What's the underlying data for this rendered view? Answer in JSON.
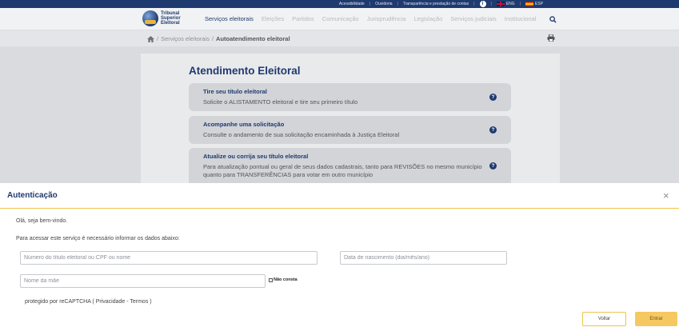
{
  "topbar": {
    "links": [
      "Acessibilidade",
      "Ouvidoria",
      "Transparência e prestação de contas"
    ],
    "languages": [
      "ENG",
      "ESP"
    ]
  },
  "nav": {
    "logo_lines": [
      "Tribunal",
      "Superior",
      "Eleitoral"
    ],
    "items": [
      "Serviços eleitorais",
      "Eleições",
      "Partidos",
      "Comunicação",
      "Jurisprudência",
      "Legislação",
      "Serviços judiciais",
      "Institucional"
    ]
  },
  "breadcrumb": {
    "separator": "/",
    "parent": "Serviços eleitorais",
    "current": "Autoatendimento eleitoral"
  },
  "card": {
    "title": "Atendimento Eleitoral",
    "help_symbol": "?",
    "services": [
      {
        "title": "Tire seu título eleitoral",
        "desc": "Solicite o ALISTAMENTO eleitoral e tire seu primeiro título"
      },
      {
        "title": "Acompanhe uma solicitação",
        "desc": "Consulte o andamento de sua solicitação encaminhada à Justiça Eleitoral"
      },
      {
        "title": "Atualize ou corrija seu título eleitoral",
        "desc": "Para atualização pontual ou geral de seus dados cadastrais, tanto para REVISÕES no mesmo município quanto para TRANSFERÊNCIAS para votar em outro município"
      }
    ]
  },
  "modal": {
    "title": "Autenticação",
    "close_symbol": "×",
    "greeting": "Olá, seja bem-vindo.",
    "instruction": "Para acessar este serviço é necessário informar os dados abaixo:",
    "titulo_placeholder": "Número do título eleitoral ou CPF ou nome",
    "nascimento_placeholder": "Data de nascimento (dia/mês/ano)",
    "mae_placeholder": "Nome da mãe",
    "nao_consta_label": "Não consta",
    "recaptcha_text": "protegido por reCAPTCHA ( Privacidade - Termos )",
    "voltar_label": "Voltar",
    "entrar_label": "Entrar"
  },
  "colors": {
    "brand_navy": "#1f3a6e",
    "accent_yellow": "#f6c862"
  }
}
